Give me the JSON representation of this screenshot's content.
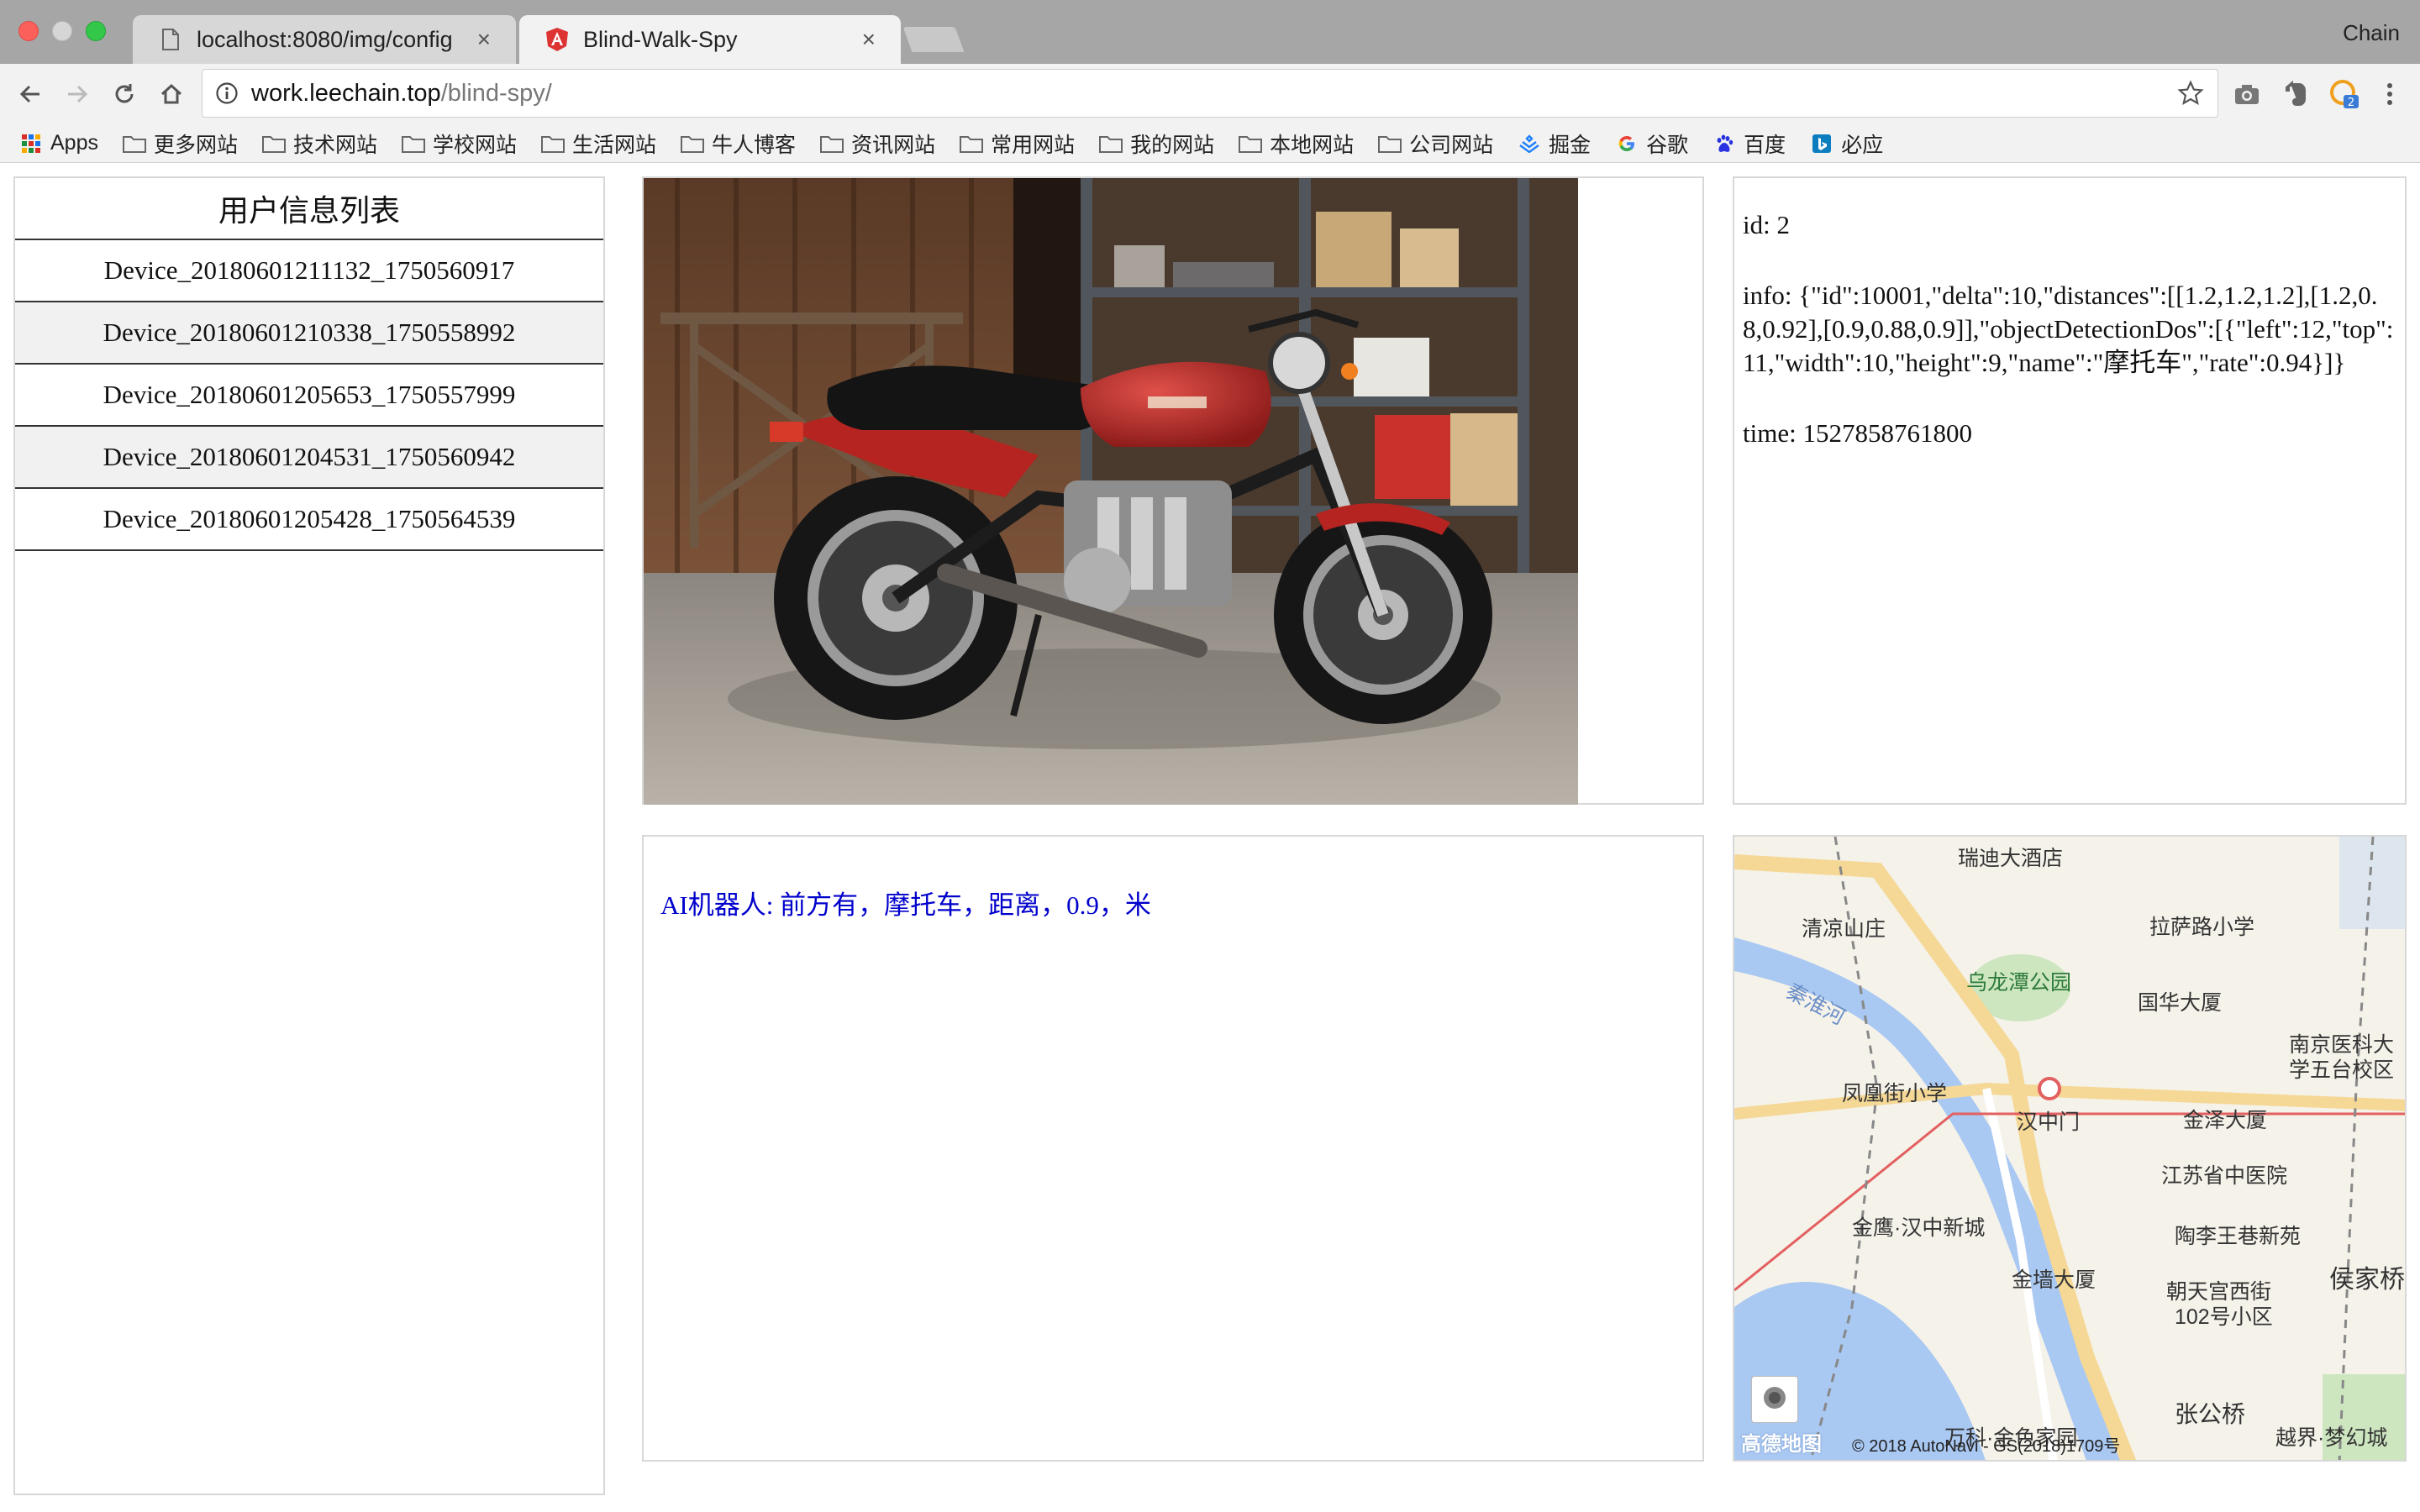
{
  "browser": {
    "tabs": [
      {
        "title": "localhost:8080/img/config",
        "close": "×"
      },
      {
        "title": "Blind-Walk-Spy",
        "close": "×"
      }
    ],
    "profile": "Chain",
    "url_host": "work.leechain.top",
    "url_path": "/blind-spy/",
    "bookmarks": [
      "Apps",
      "更多网站",
      "技术网站",
      "学校网站",
      "生活网站",
      "牛人博客",
      "资讯网站",
      "常用网站",
      "我的网站",
      "本地网站",
      "公司网站",
      "掘金",
      "谷歌",
      "百度",
      "必应"
    ]
  },
  "list": {
    "title": "用户信息列表",
    "items": [
      "Device_20180601211132_1750560917",
      "Device_20180601210338_1750558992",
      "Device_20180601205653_1750557999",
      "Device_20180601204531_1750560942",
      "Device_20180601205428_1750564539"
    ]
  },
  "detail": {
    "id": "id: 2",
    "info": "info: {\"id\":10001,\"delta\":10,\"distances\":[[1.2,1.2,1.2],[1.2,0.8,0.92],[0.9,0.88,0.9]],\"objectDetectionDos\":[{\"left\":12,\"top\":11,\"width\":10,\"height\":9,\"name\":\"摩托车\",\"rate\":0.94}]}",
    "time": "time: 1527858761800"
  },
  "message": "AI机器人: 前方有，摩托车，距离，0.9，米",
  "map": {
    "labels": [
      "瑞迪大酒店",
      "清凉山庄",
      "拉萨路小学",
      "乌龙潭公园",
      "秦淮河",
      "国华大厦",
      "南京医科大",
      "学五台校区",
      "凤凰街小学",
      "汉中门",
      "金泽大厦",
      "江苏省中医院",
      "金鹰·汉中新城",
      "陶李王巷新苑",
      "金墙大厦",
      "朝天宫西街",
      "102号小区",
      "侯家桥",
      "张公桥",
      "万科·金色家园",
      "越界·梦幻城"
    ],
    "copyright": "© 2018 AutoNavi - GS(2018)1709号",
    "logo": "高德地图"
  },
  "colors": {
    "message": "#0000cc",
    "row_alt": "#f1f1f1",
    "accent_tab": "#dd3333"
  }
}
